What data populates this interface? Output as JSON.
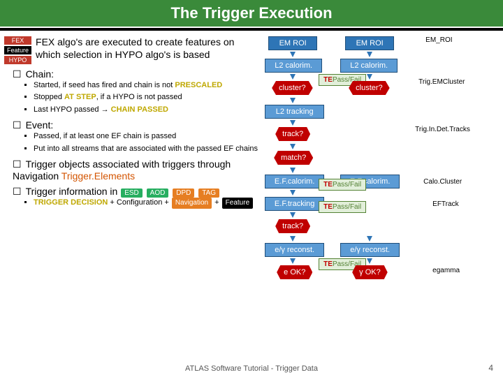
{
  "title": "The Trigger Execution",
  "intro": {
    "badges": {
      "fex": "FEX",
      "feature": "Feature",
      "hypo": "HYPO"
    },
    "text": "FEX algo's are executed to create features on which selection in HYPO algo's is based"
  },
  "sections": {
    "chain": {
      "label": "Chain:",
      "items": [
        {
          "pre": "Started, if seed has fired and chain is not ",
          "hl": "PRESCALED"
        },
        {
          "pre": "Stopped ",
          "hl": "AT STEP",
          "post": ", if a HYPO is not passed"
        },
        {
          "pre": "Last HYPO passed → ",
          "hl": "CHAIN PASSED"
        }
      ]
    },
    "event": {
      "label": "Event:",
      "items": [
        "Passed, if at least one EF chain is passed",
        "Put into all streams that are associated with the passed EF chains"
      ]
    },
    "trigobj": {
      "pre": "Trigger objects associated with triggers through Navigation ",
      "link": "Trigger.Elements"
    },
    "triginfo": {
      "pre": "Trigger information in ",
      "pills": {
        "esd": "ESD",
        "aod": "AOD",
        "dpd": "DPD",
        "tag": "TAG"
      },
      "sub": {
        "td": "TRIGGER DECISION",
        "conf": " + Configuration + ",
        "nav": "Navigation",
        "plus": " + ",
        "feat": "Feature"
      }
    }
  },
  "diagram": {
    "em_roi": "EM ROI",
    "em_roi_label": "EM_ROI",
    "l2_calorim": "L2 calorim.",
    "cluster": "cluster?",
    "trigem": "Trig.EMCluster",
    "l2_tracking": "L2 tracking",
    "track": "track?",
    "trigindet": "Trig.In.Det.Tracks",
    "match": "match?",
    "ef_calorim": "E.F.calorim.",
    "calocluster": "Calo.Cluster",
    "ef_tracking": "E.F.tracking",
    "eftrack": "EFTrack",
    "eg_reconst": "e/γ reconst.",
    "e_ok": "e OK?",
    "g_ok": "γ OK?",
    "egamma": "egamma",
    "te": "TE",
    "passfail": "Pass/Fail"
  },
  "footer": "ATLAS Software Tutorial - Trigger Data",
  "page": "4"
}
